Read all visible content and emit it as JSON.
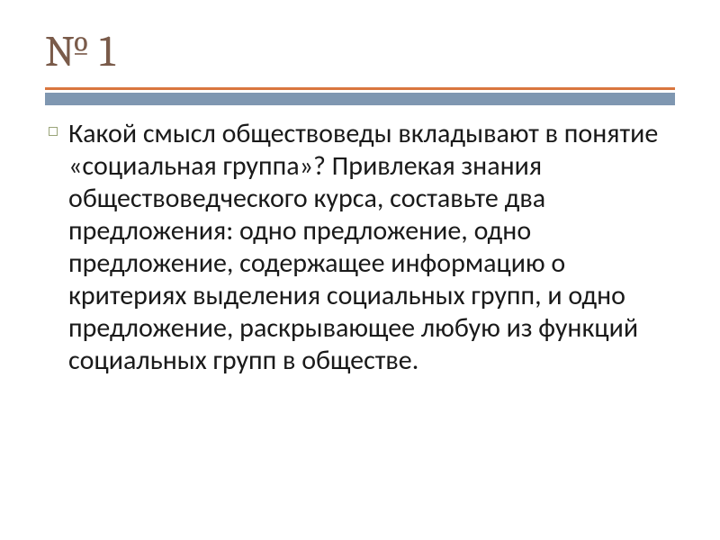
{
  "slide": {
    "title": "№ 1",
    "body": "Какой смысл обществоведы вкладывают в понятие «социальная группа»? Привлекая знания обществоведческого курса, составьте два предложения: одно предложение, одно предложение, содержащее информацию о критериях выделения социальных групп, и одно предложение, раскрывающее любую из функций социальных групп в обществе."
  }
}
